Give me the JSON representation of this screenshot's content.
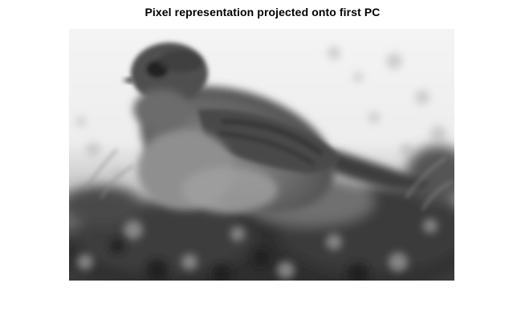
{
  "figure": {
    "title": "Pixel representation projected onto first PC",
    "image": {
      "subject": "bird-on-rocks-icon",
      "colormap": "grayscale"
    }
  }
}
